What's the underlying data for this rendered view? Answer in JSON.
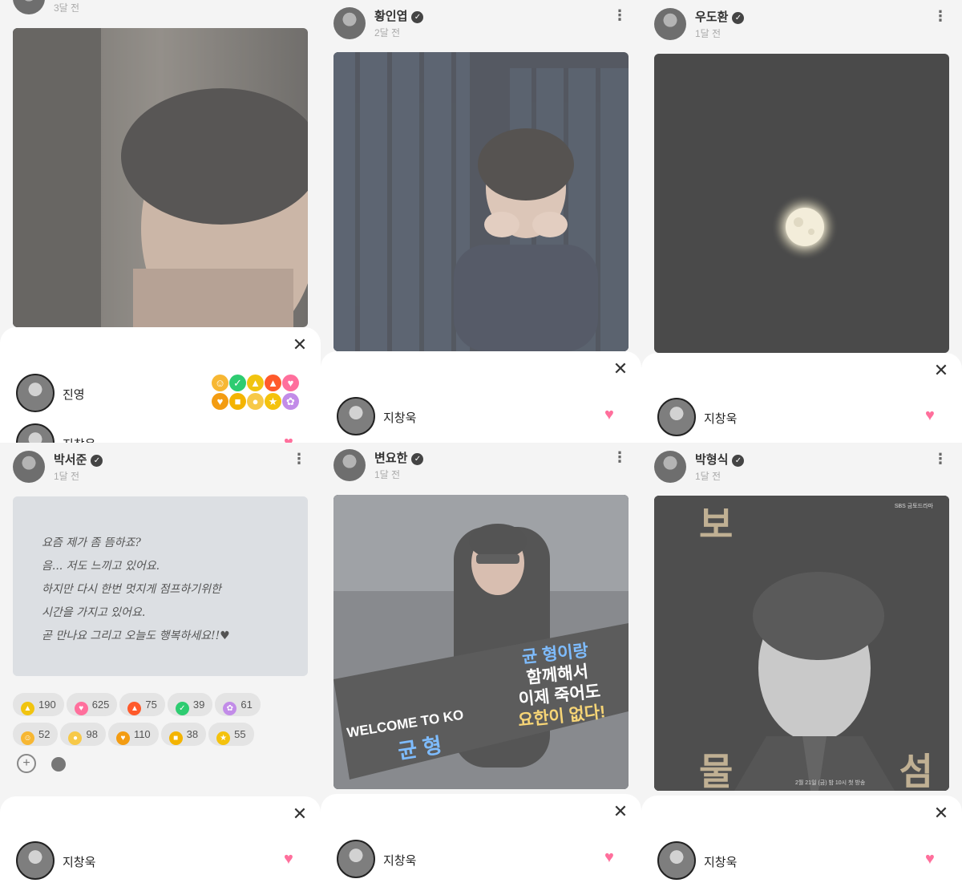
{
  "panels": [
    {
      "author": "",
      "time": "3달 전",
      "verified": false,
      "sheet_rows": [
        {
          "name": "진영",
          "picker": true
        },
        {
          "name": "지창욱",
          "picker": false
        }
      ]
    },
    {
      "author": "황인엽",
      "time": "2달 전",
      "verified": true,
      "sheet_rows": [
        {
          "name": "지창욱",
          "picker": false
        }
      ]
    },
    {
      "author": "우도환",
      "time": "1달 전",
      "verified": true,
      "sheet_rows": [
        {
          "name": "지창욱",
          "picker": false
        }
      ]
    },
    {
      "author": "박서준",
      "time": "1달 전",
      "verified": true,
      "handwritten_note": {
        "lines": [
          "요즘 제가 좀 뜸하죠?",
          "음... 저도 느끼고 있어요.",
          "하지만 다시 한번 멋지게 점프하기위한",
          "시간을 가지고 있어요.",
          "곧 만나요 그리고 오늘도 행복하세요!!♥"
        ]
      },
      "reactions": [
        {
          "icon": "thumbs-up",
          "count": "190"
        },
        {
          "icon": "heart",
          "count": "625"
        },
        {
          "icon": "fire",
          "count": "75"
        },
        {
          "icon": "check",
          "count": "39"
        },
        {
          "icon": "flower",
          "count": "61"
        },
        {
          "icon": "grin",
          "count": "52"
        },
        {
          "icon": "pleading",
          "count": "98"
        },
        {
          "icon": "heart-eyes",
          "count": "110"
        },
        {
          "icon": "sunglasses",
          "count": "38"
        },
        {
          "icon": "star",
          "count": "55"
        }
      ],
      "sheet_rows": [
        {
          "name": "지창욱",
          "picker": false
        }
      ]
    },
    {
      "author": "변요한",
      "time": "1달 전",
      "verified": true,
      "banner": {
        "welcome": "WELCOME TO KO",
        "name": "균 형",
        "lines": [
          "균 형이랑",
          "함께해서",
          "이제 죽어도",
          "요한이 없다!"
        ]
      },
      "sheet_rows": [
        {
          "name": "지창욱",
          "picker": false
        }
      ]
    },
    {
      "author": "박형식",
      "time": "1달 전",
      "verified": true,
      "poster": {
        "title_top": "보",
        "title_bottom_left": "물",
        "title_bottom_right": "섬",
        "network": "SBS 금토드라마",
        "airdate": "2월 21일 (금) 밤 10시 첫 방송"
      },
      "sheet_rows": [
        {
          "name": "지창욱",
          "picker": false
        }
      ]
    }
  ],
  "emoji_picker": [
    {
      "icon": "grin",
      "glyph": "☺",
      "color": "#f7b733"
    },
    {
      "icon": "check",
      "glyph": "✓",
      "color": "#2ecc71"
    },
    {
      "icon": "thumbs-up",
      "glyph": "▲",
      "color": "#f1c40f"
    },
    {
      "icon": "fire",
      "glyph": "▲",
      "color": "#ff5a2b"
    },
    {
      "icon": "heart",
      "glyph": "♥",
      "color": "#ff6f9c"
    },
    {
      "icon": "heart-eyes",
      "glyph": "♥",
      "color": "#f39c12"
    },
    {
      "icon": "sunglasses",
      "glyph": "■",
      "color": "#f4b400"
    },
    {
      "icon": "pleading",
      "glyph": "●",
      "color": "#f7c948"
    },
    {
      "icon": "star",
      "glyph": "★",
      "color": "#f4c20d"
    },
    {
      "icon": "flower",
      "glyph": "✿",
      "color": "#c28ce8"
    }
  ],
  "icon_colors": {
    "thumbs-up": "#f1c40f",
    "heart": "#ff6f9c",
    "fire": "#ff5a2b",
    "check": "#2ecc71",
    "flower": "#c28ce8",
    "grin": "#f7b733",
    "pleading": "#f7c948",
    "heart-eyes": "#f39c12",
    "sunglasses": "#f4b400",
    "star": "#f4c20d"
  },
  "icon_glyphs": {
    "thumbs-up": "▲",
    "heart": "♥",
    "fire": "▲",
    "check": "✓",
    "flower": "✿",
    "grin": "☺",
    "pleading": "●",
    "heart-eyes": "♥",
    "sunglasses": "■",
    "star": "★"
  },
  "ui": {
    "close_glyph": "✕",
    "more_glyph": "⋮",
    "heart_glyph": "♥",
    "verified_glyph": "✓",
    "add_reaction_glyph": "+"
  }
}
